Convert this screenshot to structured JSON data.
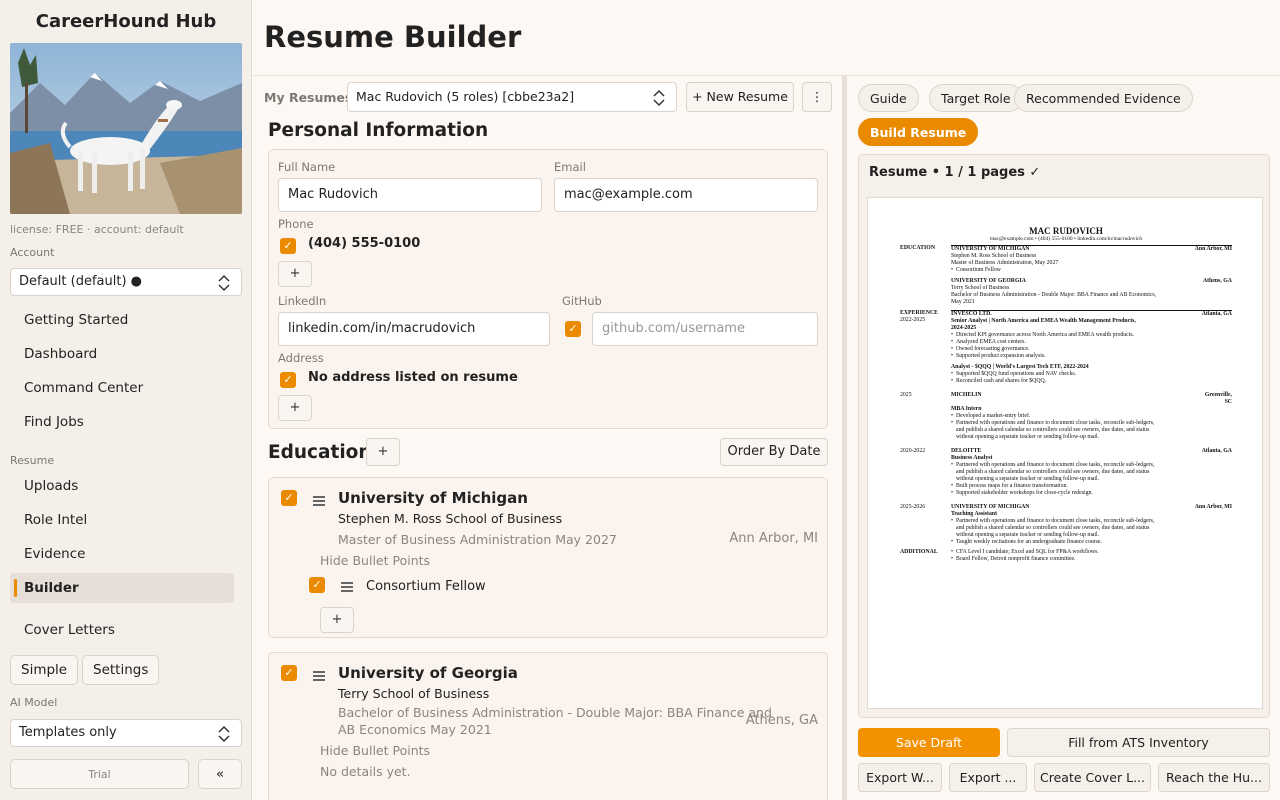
{
  "app": {
    "title": "CareerHound Hub",
    "license": "license: FREE · account: default"
  },
  "sidebar": {
    "account_label": "Account",
    "account_value": "Default (default) ●",
    "nav_top": [
      "Getting Started",
      "Dashboard",
      "Command Center",
      "Find Jobs"
    ],
    "resume_section": "Resume",
    "nav_resume": [
      "Uploads",
      "Role Intel",
      "Evidence",
      "Builder",
      "Cover Letters"
    ],
    "active_item": "Builder",
    "simple_btn": "Simple",
    "settings_btn": "Settings",
    "ai_label": "AI Model",
    "ai_value": "Templates only",
    "trial_btn": "Trial",
    "collapse_btn": "«"
  },
  "header": {
    "title": "Resume Builder"
  },
  "resumes": {
    "label": "My Resumes",
    "selected": "Mac Rudovich (5 roles) [cbbe23a2]",
    "new_btn": "+ New Resume",
    "more_btn": "⋮"
  },
  "personal": {
    "title": "Personal Information",
    "full_name_label": "Full Name",
    "full_name": "Mac Rudovich",
    "email_label": "Email",
    "email": "mac@example.com",
    "phone_label": "Phone",
    "phone": "(404) 555-0100",
    "linkedin_label": "LinkedIn",
    "linkedin": "linkedin.com/in/macrudovich",
    "github_label": "GitHub",
    "github_placeholder": "github.com/username",
    "address_label": "Address",
    "address_text": "No address listed on resume",
    "add": "+"
  },
  "education": {
    "title": "Education",
    "add": "+",
    "order_btn": "Order By Date",
    "entries": [
      {
        "school": "University of Michigan",
        "sub": "Stephen M. Ross School of Business",
        "degree": "Master of Business Administration  May 2027",
        "location": "Ann Arbor, MI",
        "hide": "Hide Bullet Points",
        "bullets": [
          "Consortium Fellow"
        ]
      },
      {
        "school": "University of Georgia",
        "sub": "Terry School of Business",
        "degree_line1": "Bachelor of Business Administration - Double Major: BBA Finance and",
        "degree_line2": "AB Economics  May 2021",
        "location": "Athens, GA",
        "hide": "Hide Bullet Points",
        "no_details": "No details yet."
      }
    ]
  },
  "right": {
    "tabs": [
      "Guide",
      "Target Role",
      "Recommended Evidence"
    ],
    "build_btn": "Build Resume",
    "preview_label": "Resume  •  1 / 1 pages ✓",
    "save_draft": "Save Draft",
    "fill_ats": "Fill from ATS Inventory",
    "export_w": "Export W...",
    "export_2": "Export ...",
    "cover": "Create Cover L...",
    "reach": "Reach the Hu..."
  },
  "doc": {
    "name": "MAC RUDOVICH",
    "contact": "mac@example.com • (404) 555-0100 • linkedin.com/in/macrudovich",
    "education_label": "EDUCATION",
    "experience_label": "EXPERIENCE",
    "additional_label": "ADDITIONAL",
    "edu": [
      {
        "school": "UNIVERSITY OF MICHIGAN",
        "loc": "Ann Arbor, MI",
        "l1": "Stephen M. Ross School of Business",
        "l2": "Master of Business Administration, May 2027",
        "b1": "Consortium Fellow"
      },
      {
        "school": "UNIVERSITY OF GEORGIA",
        "loc": "Athens, GA",
        "l1": "Terry School of Business",
        "l2": "Bachelor of Business Administration - Double Major: BBA Finance and AB Economics,",
        "l3": "May 2021"
      }
    ],
    "exp": [
      {
        "date": "2022-2025",
        "company": "INVESCO LTD.",
        "loc": "Atlanta, GA",
        "role": "Senior Analyst | North America and EMEA Wealth Management Products,",
        "role2": "2024-2025",
        "bullets": [
          "Directed KPI governance across North America and EMEA wealth products.",
          "Analyzed EMEA cost centers.",
          "Owned forecasting governance.",
          "Supported product expansion analysis."
        ],
        "role_b": "Analyst - $QQQ | World's Largest Tech ETF, 2022-2024",
        "bullets_b": [
          "Supported $QQQ fund operations and NAV checks.",
          "Reconciled cash and shares for $QQQ."
        ]
      },
      {
        "date": "2025",
        "company": "MICHELIN",
        "loc": "Greenville,",
        "loc2": "SC",
        "role": "MBA Intern",
        "bullets": [
          "Developed a market-entry brief."
        ],
        "long1": "Partnered with operations and finance to document close tasks, reconcile sub-ledgers,",
        "long2": "and publish a shared calendar so controllers could see owners, due dates, and status",
        "long3": "without opening a separate tracker or sending follow-up mail."
      },
      {
        "date": "2020-2022",
        "company": "DELOITTE",
        "loc": "Atlanta, GA",
        "role": "Business Analyst",
        "long1": "Partnered with operations and finance to document close tasks, reconcile sub-ledgers,",
        "long2": "and publish a shared calendar so controllers could see owners, due dates, and status",
        "long3": "without opening a separate tracker or sending follow-up mail.",
        "bullets": [
          "Built process maps for a finance transformation.",
          "Supported stakeholder workshops for close-cycle redesign."
        ]
      },
      {
        "date": "2025-2026",
        "company": "UNIVERSITY OF MICHIGAN",
        "loc": "Ann Arbor, MI",
        "role": "Teaching Assistant",
        "long1": "Partnered with operations and finance to document close tasks, reconcile sub-ledgers,",
        "long2": "and publish a shared calendar so controllers could see owners, due dates, and status",
        "long3": "without opening a separate tracker or sending follow-up mail.",
        "bullets": [
          "Taught weekly recitations for an undergraduate finance course."
        ]
      }
    ],
    "additional": [
      "CFA Level I candidate; Excel and SQL for FP&A workflows.",
      "Board Fellow, Detroit nonprofit finance committee."
    ]
  },
  "colors": {
    "accent": "#e98a00",
    "accent_btn": "#f39200"
  }
}
